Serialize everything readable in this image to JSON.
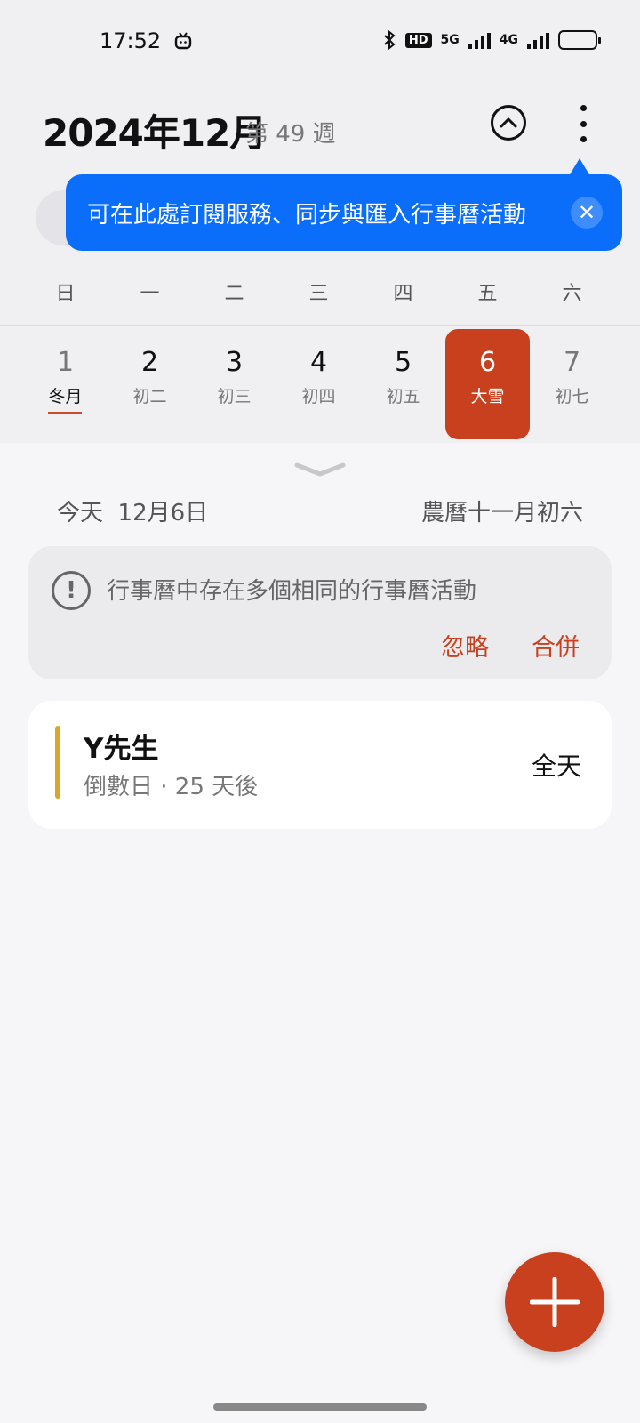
{
  "status_bar": {
    "time": "17:52",
    "network_5g": "5G",
    "network_4g": "4G",
    "hd_badge": "HD"
  },
  "header": {
    "month_title": "2024年12月",
    "week_label": "第 49 週"
  },
  "tooltip": {
    "text": "可在此處訂閱服務、同步與匯入行事曆活動",
    "close_symbol": "✕"
  },
  "calendar": {
    "weekdays": [
      "日",
      "一",
      "二",
      "三",
      "四",
      "五",
      "六"
    ],
    "days": [
      {
        "num": "1",
        "sub": "冬月"
      },
      {
        "num": "2",
        "sub": "初二"
      },
      {
        "num": "3",
        "sub": "初三"
      },
      {
        "num": "4",
        "sub": "初四"
      },
      {
        "num": "5",
        "sub": "初五"
      },
      {
        "num": "6",
        "sub": "大雪"
      },
      {
        "num": "7",
        "sub": "初七"
      }
    ]
  },
  "today": {
    "label": "今天  12月6日",
    "lunar": "農曆十一月初六"
  },
  "warning": {
    "text": "行事曆中存在多個相同的行事曆活動",
    "ignore": "忽略",
    "merge": "合併"
  },
  "event": {
    "title": "Y先生",
    "subtitle": "倒數日 · 25 天後",
    "time": "全天"
  },
  "colors": {
    "accent": "#c9401f",
    "tooltip_blue": "#0a6efb",
    "event_bar": "#d8a72a"
  }
}
